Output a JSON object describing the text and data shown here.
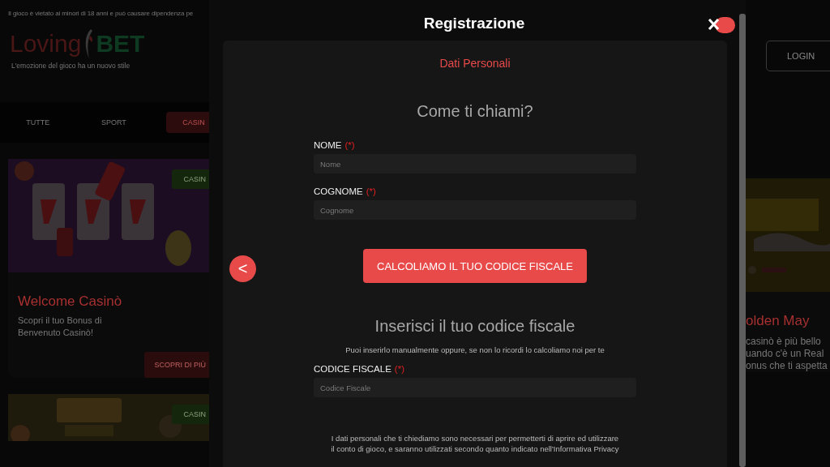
{
  "background_page": {
    "notice": "Il gioco è vietato ai minori di 18 anni e può causare dipendenza pe",
    "logo": {
      "part_1": "Loving",
      "part_2": "BET"
    },
    "tagline": "L'emozione del gioco ha un nuovo stile",
    "categories": [
      {
        "label": "TUTTE",
        "selected": false
      },
      {
        "label": "SPORT",
        "selected": false
      },
      {
        "label": "CASIN",
        "selected": true
      }
    ],
    "login_button": "LOGIN",
    "left_cards": [
      {
        "badge": "CASIN",
        "title": "Welcome Casinò",
        "text": "Scopri il tuo Bonus di Benvenuto Casinò!",
        "button": "SCOPRI DI PIÙ"
      },
      {
        "badge": "CASIN"
      }
    ],
    "right_card": {
      "title": "olden May",
      "text_lines": [
        "casinò è più bello",
        "uando c'è un Real",
        "onus che ti aspetta"
      ]
    }
  },
  "modal": {
    "title": "Registrazione",
    "step": "Dati Personali",
    "heading": "Come ti chiami?",
    "name_fields": [
      {
        "label": "NOME",
        "required_mark": "(*)",
        "placeholder": "Nome"
      },
      {
        "label": "COGNOME",
        "required_mark": "(*)",
        "placeholder": "Cognome"
      }
    ],
    "calculate_button": "CALCOLIAMO IL TUO CODICE FISCALE",
    "back_button": "<",
    "fiscal_heading": "Inserisci il tuo codice fiscale",
    "fiscal_hint": "Puoi inserirlo manualmente oppure, se non lo ricordi lo calcoliamo noi per te",
    "fiscal_field": {
      "label": "CODICE FISCALE",
      "required_mark": "(*)",
      "placeholder": "Codice Fiscale"
    },
    "privacy_note": "I dati personali che ti chiediamo sono necessari per permetterti di aprire ed utilizzare il conto di gioco, e saranno utilizzati secondo quanto indicato nell'Informativa Privacy"
  }
}
